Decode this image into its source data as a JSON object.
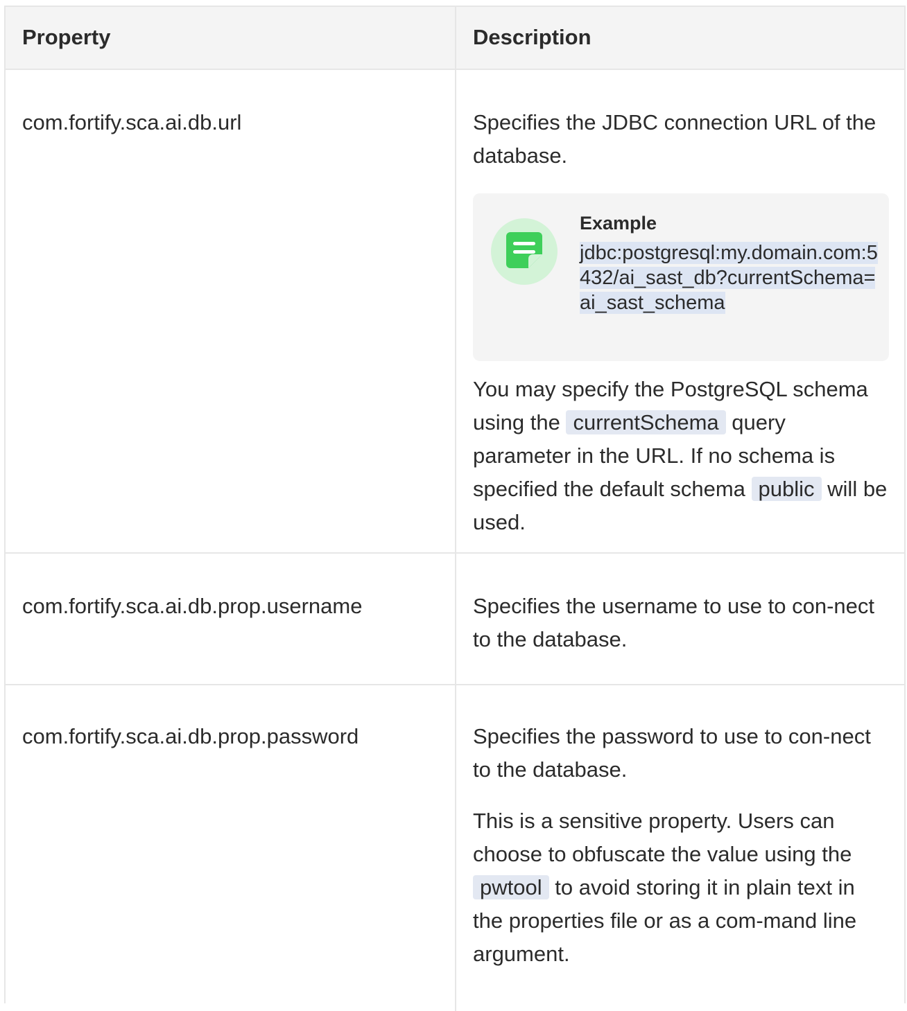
{
  "table": {
    "headers": {
      "property": "Property",
      "description": "Description"
    },
    "rows": [
      {
        "property": "com.fortify.sca.ai.db.url",
        "desc1": "Specifies the JDBC connection URL of the database.",
        "example": {
          "title": "Example",
          "code": "jdbc:postgresql:my.domain.com:5432/ai_sast_db?currentSchema=ai_sast_schema",
          "icon": "note-icon",
          "icon_color": "#3ecf5a",
          "icon_bg": "#d3f3d7"
        },
        "desc2": {
          "before": "You may specify the PostgreSQL schema using the",
          "code1": "currentSchema",
          "middle": "query parameter in the URL. If no schema is specified the default schema",
          "code2": "public",
          "after": "will be used."
        }
      },
      {
        "property": "com.fortify.sca.ai.db.prop.username",
        "desc1": "Specifies the username to use to con-nect to the database."
      },
      {
        "property": "com.fortify.sca.ai.db.prop.password",
        "desc1": "Specifies the password to use to con-nect to the database.",
        "desc2": {
          "before": "This is a sensitive property. Users can choose to obfuscate the value using the",
          "code1": "pwtool",
          "after": "to avoid storing it in plain text in the properties file or as a com-mand line argument."
        }
      }
    ]
  },
  "colors": {
    "border": "#e6e6e6",
    "header_bg": "#f4f4f4",
    "code_bg": "#e3e8f2",
    "text": "#2b2b2b"
  }
}
